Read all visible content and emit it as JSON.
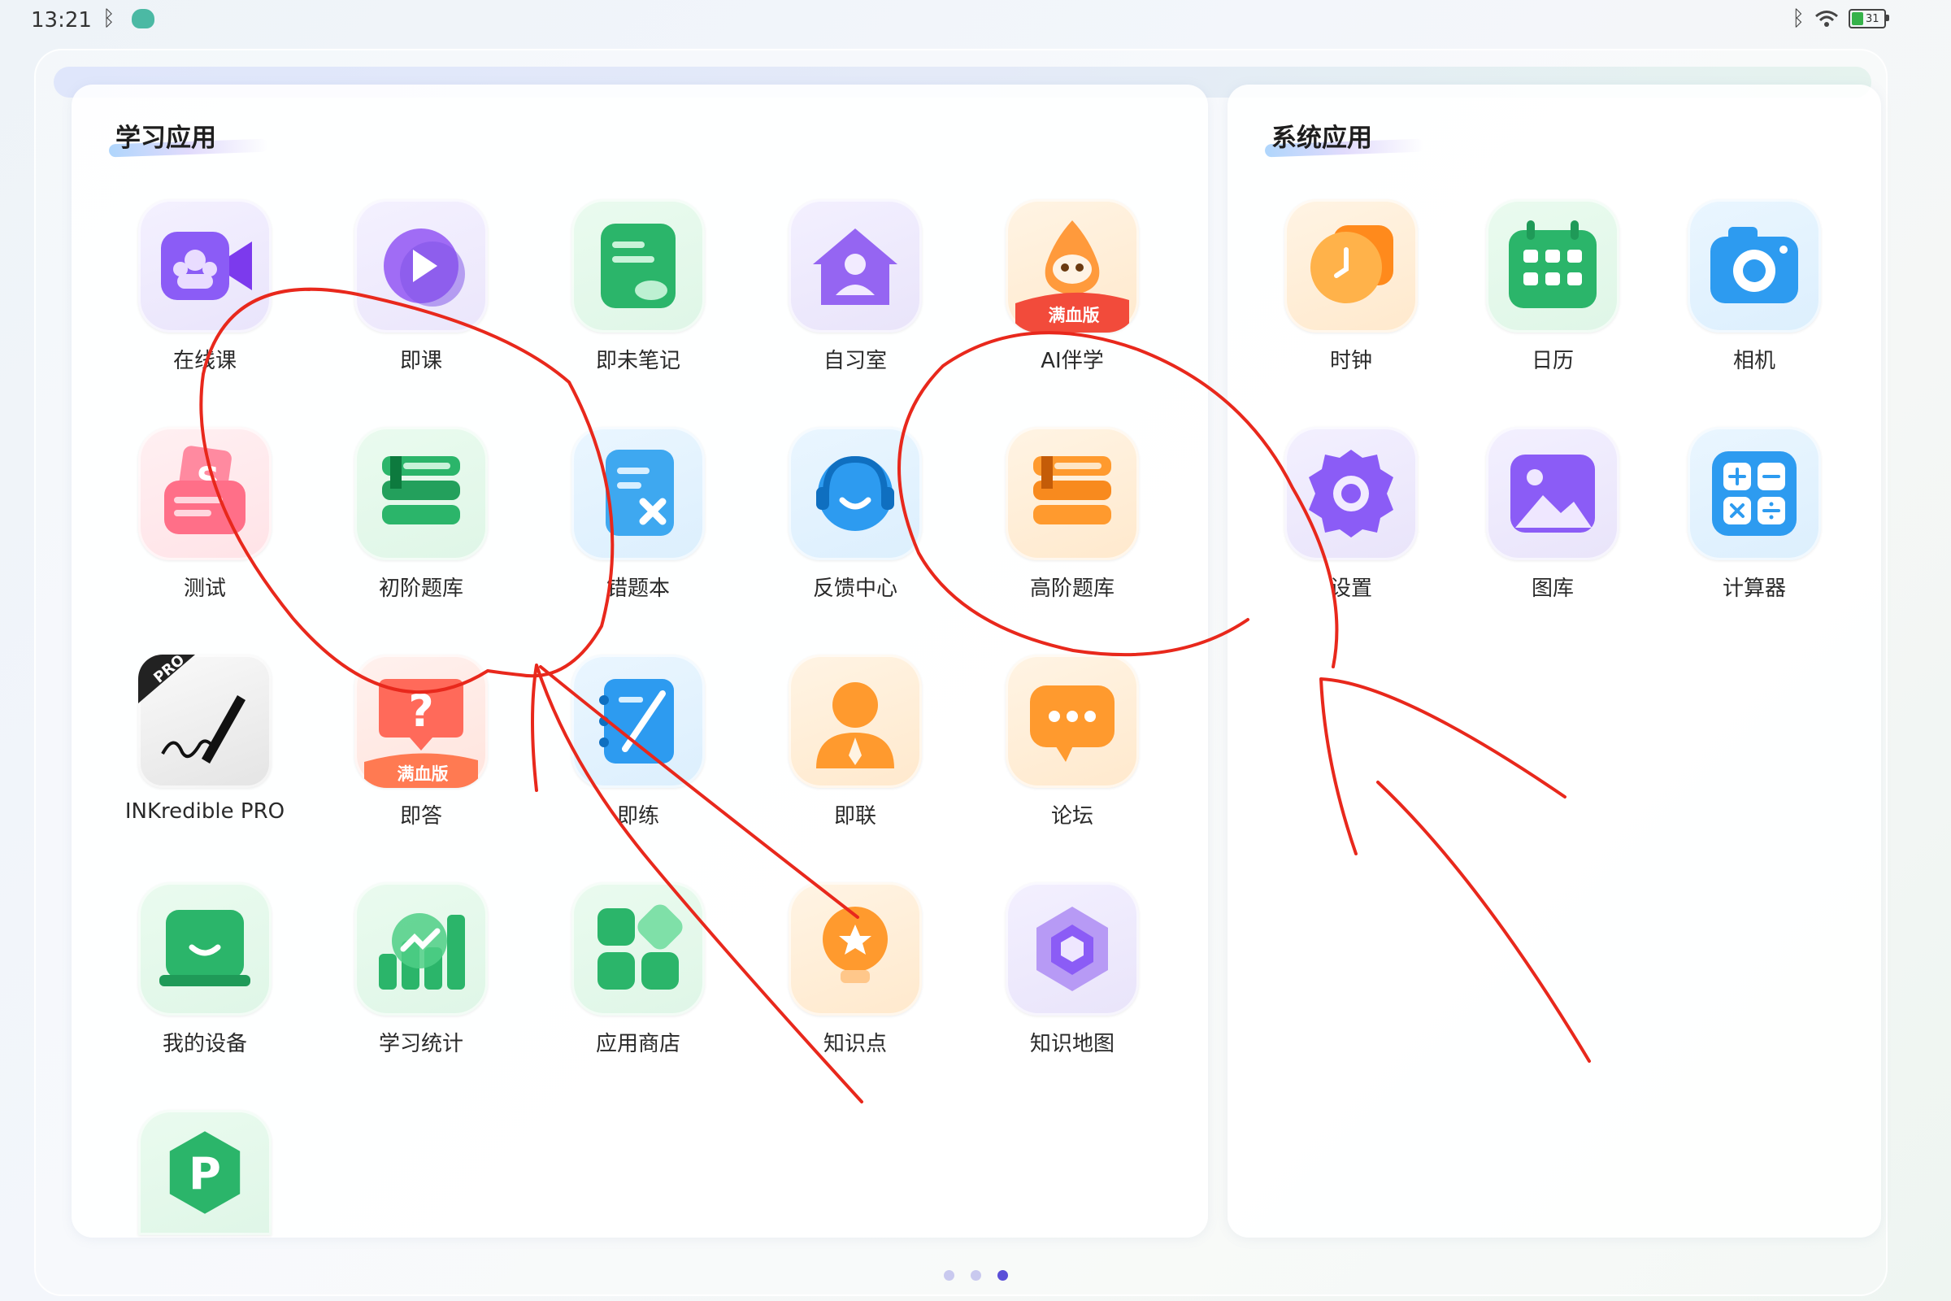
{
  "status_bar": {
    "time": "13:21",
    "bluetooth_icon": "bluetooth-icon",
    "app_badge_icon": "owl-app-icon",
    "battery_level": "31",
    "wifi_icon": "wifi-icon"
  },
  "left_panel": {
    "title": "学习应用",
    "apps": [
      {
        "label": "在线课",
        "icon": "video-class-icon"
      },
      {
        "label": "即课",
        "icon": "play-lesson-icon"
      },
      {
        "label": "即未笔记",
        "icon": "note-icon"
      },
      {
        "label": "自习室",
        "icon": "study-room-icon"
      },
      {
        "label": "AI伴学",
        "icon": "ai-mascot-icon",
        "badge": "满血版"
      },
      {
        "label": "测试",
        "icon": "test-paper-icon"
      },
      {
        "label": "初阶题库",
        "icon": "question-bank-green-icon"
      },
      {
        "label": "错题本",
        "icon": "mistake-book-icon"
      },
      {
        "label": "反馈中心",
        "icon": "feedback-headset-icon"
      },
      {
        "label": "高阶题库",
        "icon": "question-bank-orange-icon"
      },
      {
        "label": "INKredible PRO",
        "icon": "inkredible-pen-icon",
        "badge": "PRO"
      },
      {
        "label": "即答",
        "icon": "question-answer-icon",
        "badge": "满血版"
      },
      {
        "label": "即练",
        "icon": "practice-notebook-icon"
      },
      {
        "label": "即联",
        "icon": "tutor-person-icon"
      },
      {
        "label": "论坛",
        "icon": "forum-chat-icon"
      },
      {
        "label": "我的设备",
        "icon": "device-icon"
      },
      {
        "label": "学习统计",
        "icon": "statistics-icon"
      },
      {
        "label": "应用商店",
        "icon": "app-store-icon"
      },
      {
        "label": "知识点",
        "icon": "knowledge-bulb-icon"
      },
      {
        "label": "知识地图",
        "icon": "knowledge-map-icon"
      },
      {
        "label": "",
        "icon": "p-app-icon",
        "badge": "P"
      }
    ]
  },
  "right_panel": {
    "title": "系统应用",
    "apps": [
      {
        "label": "时钟",
        "icon": "clock-icon"
      },
      {
        "label": "日历",
        "icon": "calendar-icon"
      },
      {
        "label": "相机",
        "icon": "camera-icon"
      },
      {
        "label": "设置",
        "icon": "gear-icon"
      },
      {
        "label": "图库",
        "icon": "gallery-icon"
      },
      {
        "label": "计算器",
        "icon": "calculator-icon"
      }
    ]
  },
  "pagination": {
    "total": 3,
    "active": 3
  },
  "colors": {
    "annotation_red": "#e8281c",
    "active_dot": "#5b4fd8",
    "inactive_dot": "#c9c9ef"
  }
}
